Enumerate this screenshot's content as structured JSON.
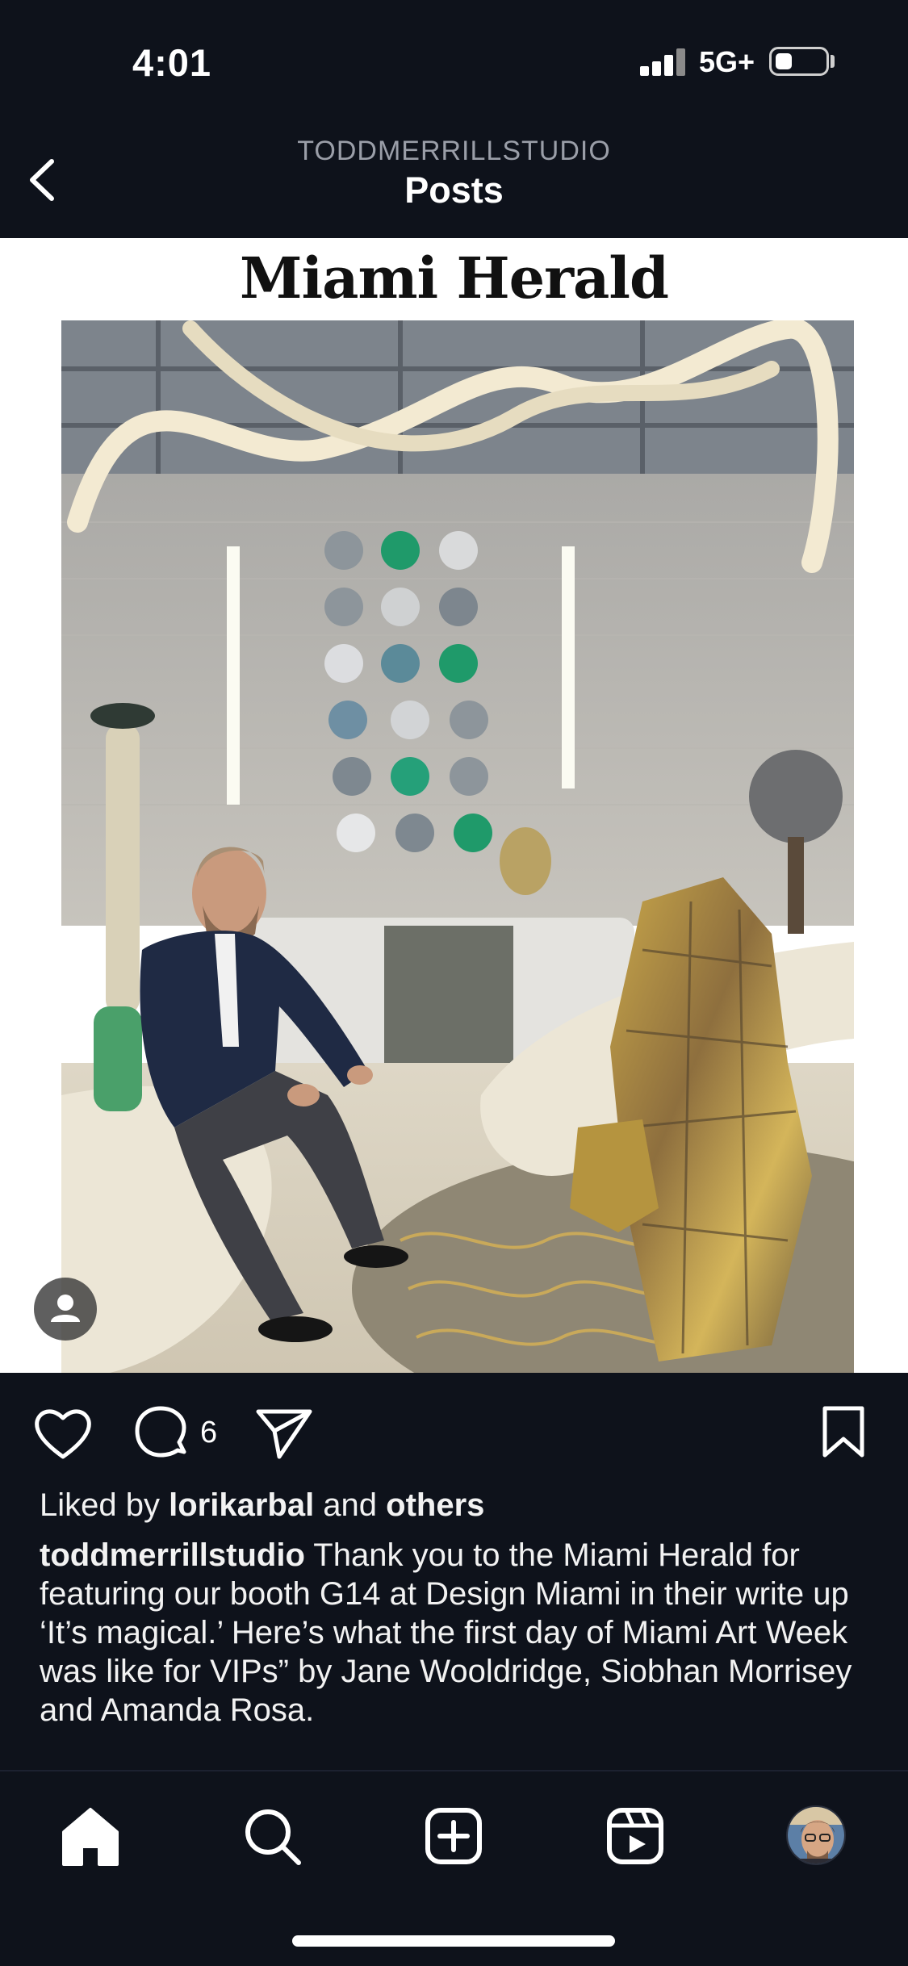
{
  "status_bar": {
    "time": "4:01",
    "network": "5G+",
    "signal_bars": 4,
    "battery_level": 0.2
  },
  "header": {
    "account": "TODDMERRILLSTUDIO",
    "title": "Posts",
    "back_icon": "chevron-left-icon"
  },
  "post": {
    "masthead": "Miami Herald",
    "actions": {
      "like_icon": "heart-icon",
      "comment_icon": "comment-icon",
      "comment_count": "6",
      "share_icon": "send-icon",
      "save_icon": "bookmark-icon"
    },
    "likes": {
      "prefix": "Liked by ",
      "user": "lorikarbal",
      "middle": " and ",
      "others": "others"
    },
    "caption": {
      "username": "toddmerrillstudio",
      "text": " Thank you to the Miami Herald for featuring our booth G14 at Design Miami in their write up ‘It’s magical.’ Here’s what the first day of Miami Art Week was like for VIPs” by  Jane Wooldridge, Siobhan Morrisey and Amanda Rosa."
    }
  },
  "tab_bar": {
    "items": [
      "home-icon",
      "search-icon",
      "create-icon",
      "reels-icon",
      "profile-avatar"
    ]
  },
  "colors": {
    "background": "#0e121b",
    "text": "#ffffff",
    "muted": "#9a9ea8"
  }
}
